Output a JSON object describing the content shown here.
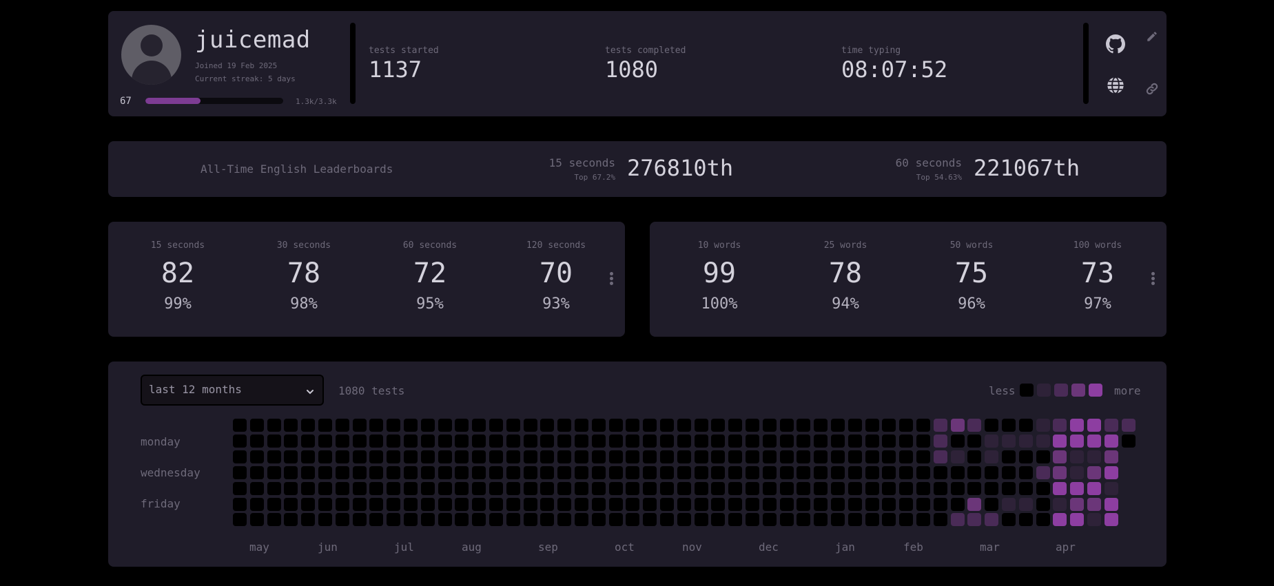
{
  "profile": {
    "username": "juicemad",
    "joined": "Joined 19 Feb 2025",
    "streak": "Current streak: 5 days",
    "level": "67",
    "xp_text": "1.3k/3.3k",
    "xp_progress": 0.4
  },
  "stats": [
    {
      "label": "tests started",
      "value": "1137"
    },
    {
      "label": "tests completed",
      "value": "1080"
    },
    {
      "label": "time typing",
      "value": "08:07:52"
    }
  ],
  "leaderboards": {
    "title": "All-Time English Leaderboards",
    "entries": [
      {
        "mode": "15 seconds",
        "top": "Top 67.2%",
        "rank": "276810th"
      },
      {
        "mode": "60 seconds",
        "top": "Top 54.63%",
        "rank": "221067th"
      }
    ]
  },
  "pb_time": [
    {
      "mode": "15 seconds",
      "wpm": "82",
      "acc": "99%"
    },
    {
      "mode": "30 seconds",
      "wpm": "78",
      "acc": "98%"
    },
    {
      "mode": "60 seconds",
      "wpm": "72",
      "acc": "95%"
    },
    {
      "mode": "120 seconds",
      "wpm": "70",
      "acc": "93%"
    }
  ],
  "pb_words": [
    {
      "mode": "10 words",
      "wpm": "99",
      "acc": "100%"
    },
    {
      "mode": "25 words",
      "wpm": "78",
      "acc": "94%"
    },
    {
      "mode": "50 words",
      "wpm": "75",
      "acc": "96%"
    },
    {
      "mode": "100 words",
      "wpm": "73",
      "acc": "97%"
    }
  ],
  "activity": {
    "range": "last 12 months",
    "count": "1080 tests",
    "legend_less": "less",
    "legend_more": "more",
    "days": [
      "monday",
      "wednesday",
      "friday"
    ],
    "months": [
      "may",
      "jun",
      "jul",
      "aug",
      "sep",
      "oct",
      "nov",
      "dec",
      "jan",
      "feb",
      "mar",
      "apr"
    ],
    "palette": [
      "#000000",
      "#2e2238",
      "#4a2b57",
      "#6b3679",
      "#8d3ea1"
    ],
    "heatmap_recent": [
      [
        "2",
        "2",
        "2",
        "0",
        "0",
        "0",
        "0"
      ],
      [
        "3",
        "0",
        "1",
        "0",
        "0",
        "0",
        "2"
      ],
      [
        "2",
        "0",
        "0",
        "0",
        "0",
        "3",
        "2"
      ],
      [
        "0",
        "1",
        "1",
        "0",
        "0",
        "0",
        "2"
      ],
      [
        "0",
        "1",
        "0",
        "0",
        "0",
        "1",
        "0"
      ],
      [
        "0",
        "1",
        "0",
        "0",
        "0",
        "1",
        "0"
      ],
      [
        "1",
        "1",
        "0",
        "2",
        "0",
        "0",
        "0"
      ],
      [
        "2",
        "4",
        "3",
        "3",
        "4",
        "1",
        "4"
      ],
      [
        "4",
        "4",
        "1",
        "1",
        "4",
        "3",
        "4"
      ],
      [
        "4",
        "4",
        "1",
        "3",
        "4",
        "3",
        "1"
      ],
      [
        "2",
        "4",
        "3",
        "4",
        "1",
        "4",
        "4"
      ],
      [
        "2",
        "0",
        "-",
        "-",
        "-",
        "-",
        "-"
      ]
    ]
  },
  "colors": {
    "accent": "#7d3c93",
    "card": "#1f1c29",
    "text_dim": "#6e6a7a",
    "text": "#d4d2dc"
  }
}
